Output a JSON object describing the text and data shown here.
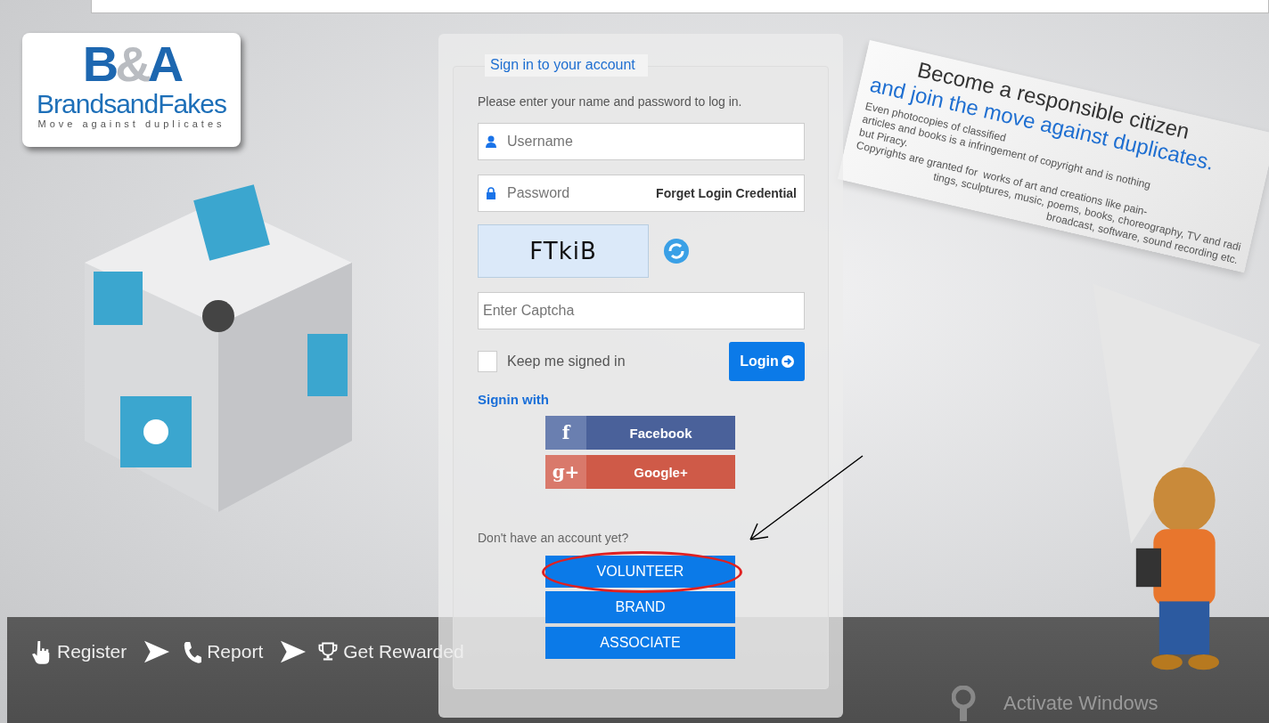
{
  "logo": {
    "mark_left": "B",
    "mark_amp": "&",
    "mark_right": "A",
    "name": "BrandsandFakes",
    "tagline": "Move against duplicates"
  },
  "login": {
    "title": "Sign in to your account",
    "intro": "Please enter your name and password to log in.",
    "username": {
      "placeholder": "Username"
    },
    "password": {
      "placeholder": "Password"
    },
    "forgot_link": "Forget Login Credential",
    "captcha_text": "FTkiB",
    "captcha_input": {
      "placeholder": "Enter Captcha"
    },
    "keep_signed_in": {
      "label": "Keep me signed in",
      "checked": false
    },
    "login_button": "Login",
    "signin_with": "Signin with",
    "social": [
      {
        "kind": "facebook",
        "icon": "f",
        "label": "Facebook"
      },
      {
        "kind": "google",
        "icon": "g+",
        "label": "Google+"
      }
    ],
    "no_account": "Don't have an account yet?",
    "register_buttons": [
      "VOLUNTEER",
      "BRAND",
      "ASSOCIATE"
    ]
  },
  "promo": {
    "headline": "Become a responsible citizen",
    "headline_highlight": "and join the move against duplicates.",
    "body": [
      "Even photocopies of classified",
      "articles and books is a infringement of copyright and is nothing",
      "but Piracy.",
      "Copyrights are granted for  works of art and creations like pain-",
      "tings, sculptures, music, poems, books, choreography, TV and radi",
      "broadcast, software, sound recording etc."
    ]
  },
  "steps": [
    {
      "kind": "register",
      "label": "Register"
    },
    {
      "kind": "report",
      "label": "Report"
    },
    {
      "kind": "reward",
      "label": "Get Rewarded"
    }
  ],
  "activate_windows": "Activate Windows"
}
